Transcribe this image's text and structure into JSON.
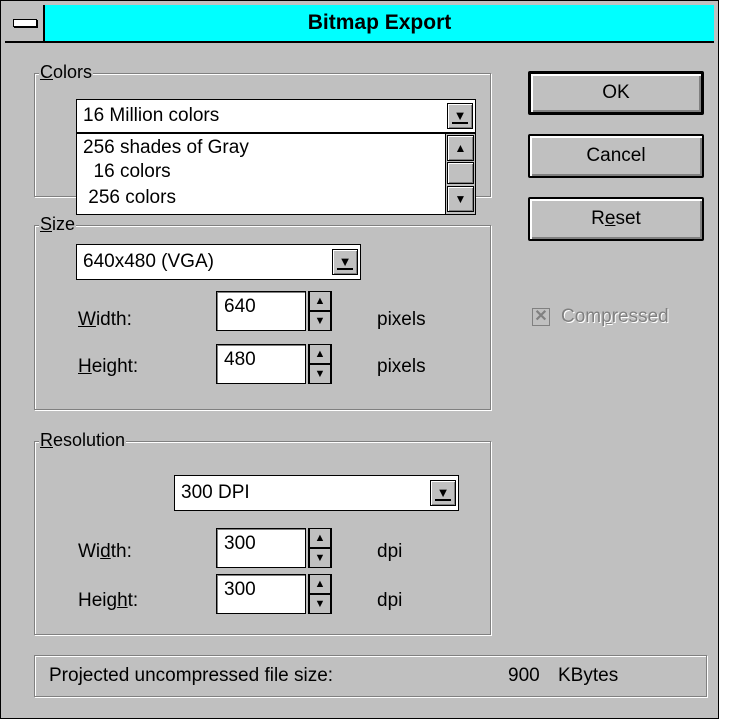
{
  "window": {
    "title": "Bitmap Export"
  },
  "colors": {
    "legend_first": "C",
    "legend_rest": "olors",
    "selected": "16 Million colors",
    "options": [
      "256 shades of Gray",
      "  16 colors",
      " 256 colors"
    ]
  },
  "size": {
    "legend_first": "S",
    "legend_rest": "ize",
    "preset": "640x480 (VGA)",
    "width_label_u": "W",
    "width_label_rest": "idth:",
    "width_value": "640",
    "width_unit": "pixels",
    "height_label_u": "H",
    "height_label_rest": "eight:",
    "height_value": "480",
    "height_unit": "pixels"
  },
  "resolution": {
    "legend_first": "R",
    "legend_rest": "esolution",
    "preset": "300 DPI",
    "width_label_pre": "Wi",
    "width_label_u": "d",
    "width_label_rest": "th:",
    "width_value": "300",
    "width_unit": "dpi",
    "height_label_pre": "Heig",
    "height_label_u": "h",
    "height_label_rest": "t:",
    "height_value": "300",
    "height_unit": "dpi"
  },
  "buttons": {
    "ok": "OK",
    "cancel": "Cancel",
    "reset_first": "R",
    "reset_u": "e",
    "reset_rest": "set"
  },
  "compressed": {
    "checked": true,
    "label_pre": "Com",
    "label_u": "p",
    "label_rest": "ressed"
  },
  "status": {
    "label": "Projected uncompressed file size:",
    "value": "900",
    "unit": "KBytes"
  },
  "icons": {
    "dropdown": "arrow-down-underline-icon",
    "scroll_up": "arrow-up-icon",
    "scroll_down": "arrow-down-icon"
  }
}
